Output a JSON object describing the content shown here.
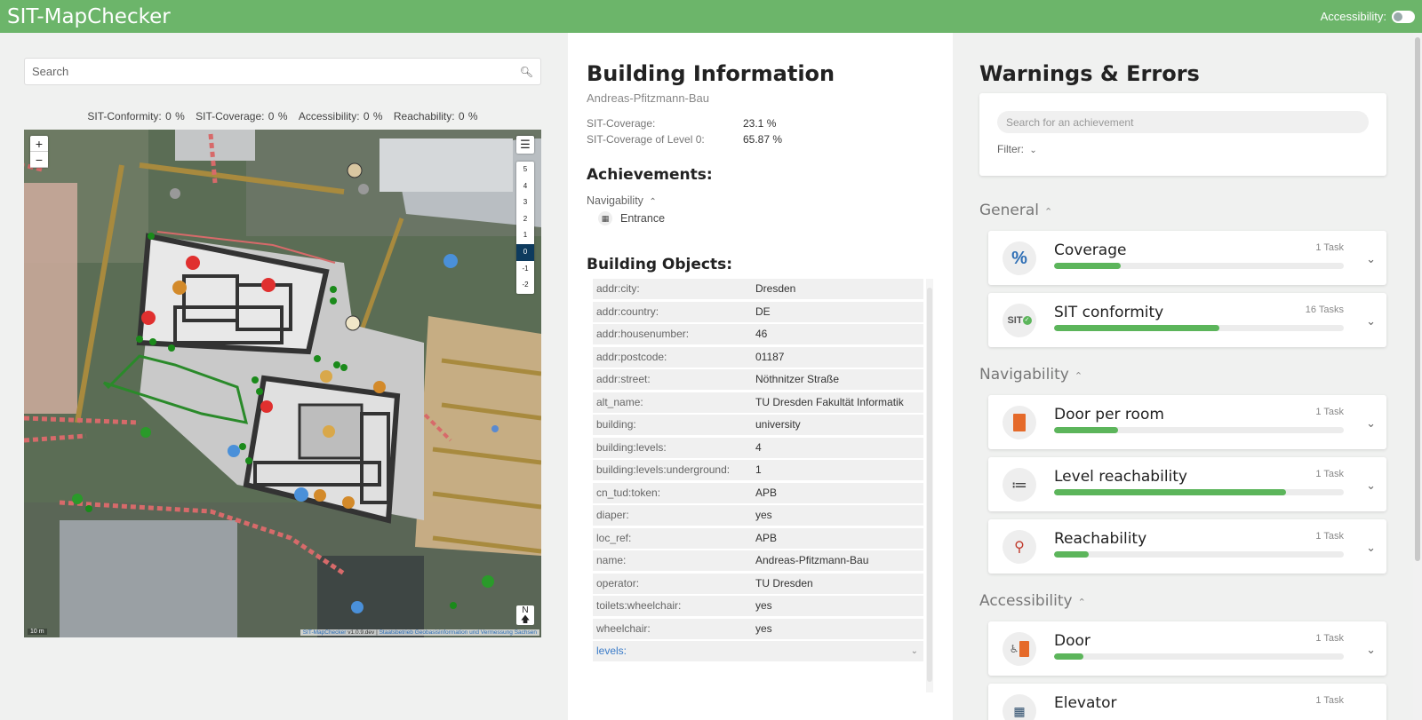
{
  "header": {
    "title": "SIT-MapChecker",
    "accessibility_label": "Accessibility:"
  },
  "search": {
    "placeholder": "Search"
  },
  "stats": {
    "sit_conformity": "SIT-Conformity: 0 %",
    "sit_coverage": "SIT-Coverage: 0 %",
    "accessibility": "Accessibility: 0 %",
    "reachability": "Reachability: 0 %"
  },
  "map": {
    "zoom_in": "+",
    "zoom_out": "−",
    "levels": [
      "5",
      "4",
      "3",
      "2",
      "1",
      "0",
      "-1",
      "-2"
    ],
    "active_level": "0",
    "scale": "10 m",
    "attribution_app": "SIT-MapChecker",
    "attribution_version": " v1.0.9.dev | ",
    "attribution_source": "Staatsbetrieb Geobasisinformation und Vermessung Sachsen"
  },
  "building": {
    "title": "Building Information",
    "name": "Andreas-Pfitzmann-Bau",
    "coverage_label": "SIT-Coverage:",
    "coverage_value": "23.1 %",
    "coverage_level_label": "SIT-Coverage of Level 0:",
    "coverage_level_value": "65.87 %",
    "achievements_title": "Achievements:",
    "navigability_label": "Navigability",
    "entrance_label": "Entrance",
    "objects_title": "Building Objects:",
    "objects": [
      {
        "key": "addr:city:",
        "value": "Dresden"
      },
      {
        "key": "addr:country:",
        "value": "DE"
      },
      {
        "key": "addr:housenumber:",
        "value": "46"
      },
      {
        "key": "addr:postcode:",
        "value": "01187"
      },
      {
        "key": "addr:street:",
        "value": "Nöthnitzer Straße"
      },
      {
        "key": "alt_name:",
        "value": "TU Dresden Fakultät Informatik"
      },
      {
        "key": "building:",
        "value": "university"
      },
      {
        "key": "building:levels:",
        "value": "4"
      },
      {
        "key": "building:levels:underground:",
        "value": "1"
      },
      {
        "key": "cn_tud:token:",
        "value": "APB"
      },
      {
        "key": "diaper:",
        "value": "yes"
      },
      {
        "key": "loc_ref:",
        "value": "APB"
      },
      {
        "key": "name:",
        "value": "Andreas-Pfitzmann-Bau"
      },
      {
        "key": "operator:",
        "value": "TU Dresden"
      },
      {
        "key": "toilets:wheelchair:",
        "value": "yes"
      },
      {
        "key": "wheelchair:",
        "value": "yes"
      }
    ],
    "levels_label": "levels:"
  },
  "warnings": {
    "title": "Warnings & Errors",
    "search_placeholder": "Search for an achievement",
    "filter_label": "Filter:",
    "sections": [
      {
        "name": "General"
      },
      {
        "name": "Navigability"
      },
      {
        "name": "Accessibility"
      }
    ],
    "tasks": [
      {
        "name": "Coverage",
        "count": "1 Task",
        "progress": 0.23,
        "icon": "percent-icon"
      },
      {
        "name": "SIT conformity",
        "count": "16 Tasks",
        "progress": 0.57,
        "icon": "sit-check-icon"
      },
      {
        "name": "Door per room",
        "count": "1 Task",
        "progress": 0.22,
        "icon": "door-icon"
      },
      {
        "name": "Level reachability",
        "count": "1 Task",
        "progress": 0.8,
        "icon": "stairs-icon"
      },
      {
        "name": "Reachability",
        "count": "1 Task",
        "progress": 0.12,
        "icon": "route-icon"
      },
      {
        "name": "Door",
        "count": "1 Task",
        "progress": 0.1,
        "icon": "wheelchair-door-icon"
      },
      {
        "name": "Elevator",
        "count": "1 Task",
        "progress": 0.0,
        "icon": "elevator-icon"
      }
    ]
  },
  "colors": {
    "header": "#6cb56a",
    "progress": "#5cb55b",
    "link": "#3a7bc8"
  }
}
